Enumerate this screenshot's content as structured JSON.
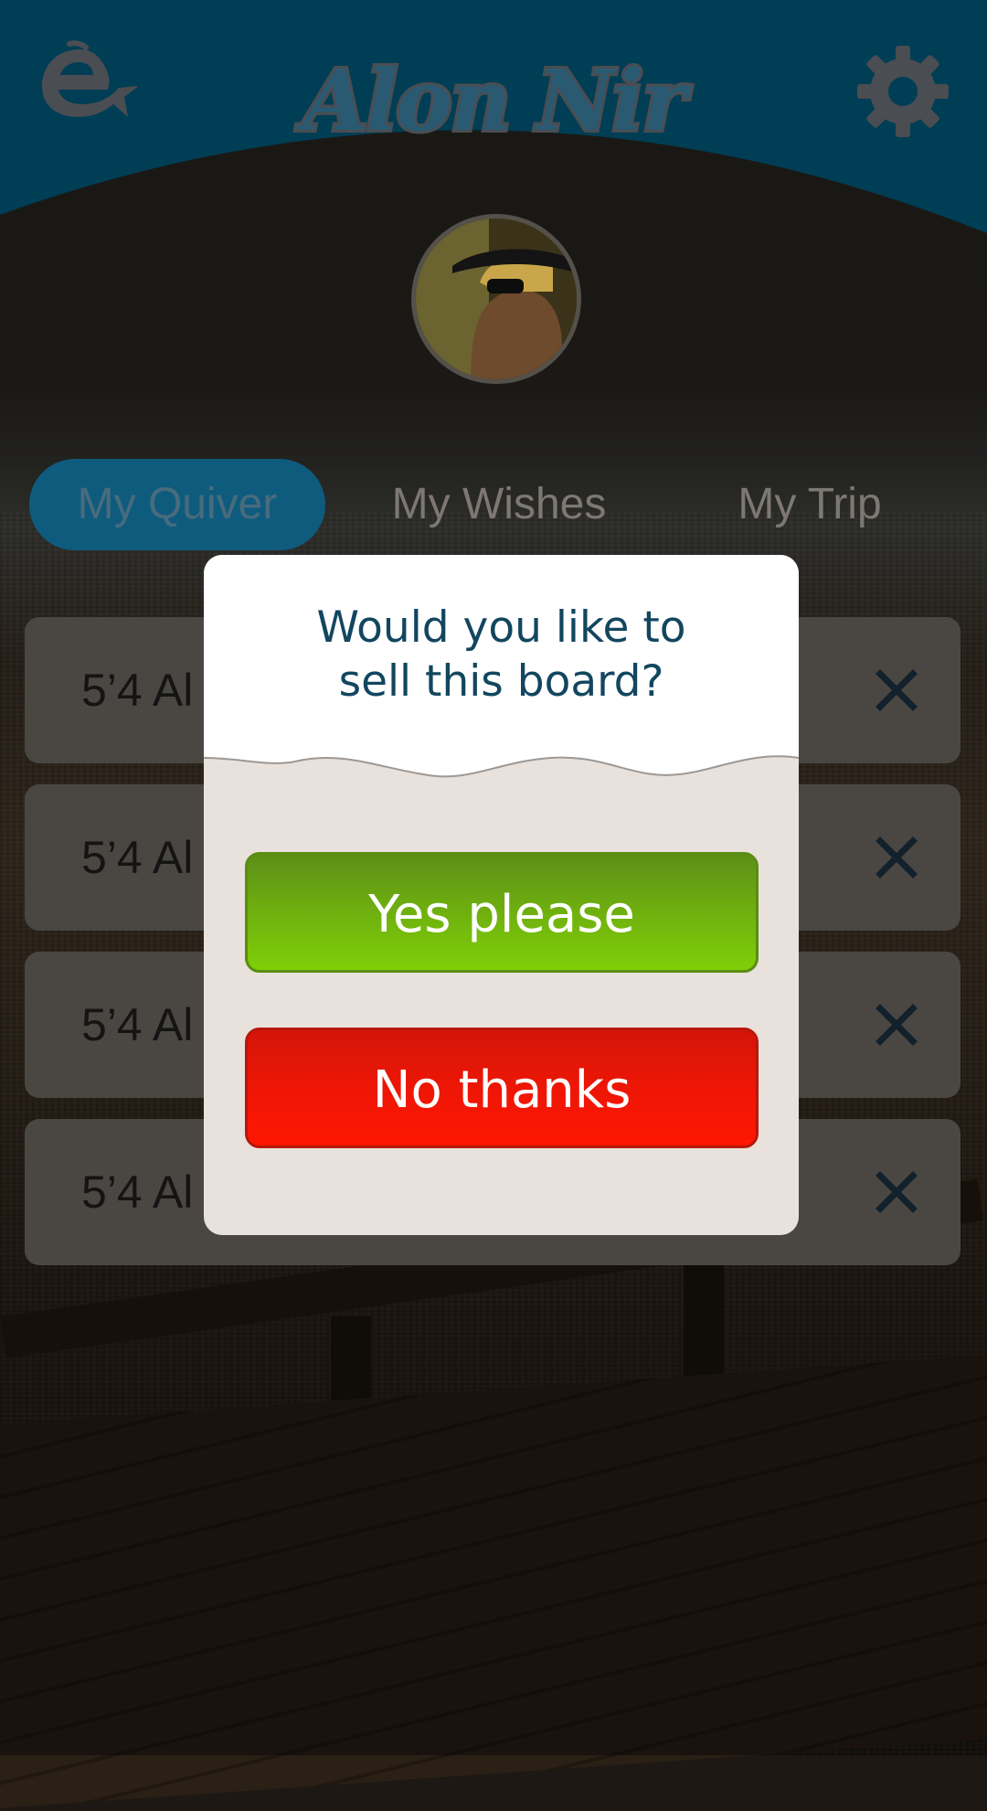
{
  "header": {
    "title": "Alon Nir",
    "logo_icon": "fish-logo-icon",
    "settings_icon": "gear-icon",
    "bar_color": "#003e55"
  },
  "profile": {
    "avatar_icon": "user-avatar"
  },
  "tabs": [
    {
      "label": "My Quiver",
      "active": true
    },
    {
      "label": "My Wishes",
      "active": false
    },
    {
      "label": "My Trip",
      "active": false
    }
  ],
  "boards": [
    {
      "label": "5’4 Al"
    },
    {
      "label": "5’4 Al"
    },
    {
      "label": "5’4 Al"
    },
    {
      "label": "5’4 Al"
    }
  ],
  "modal": {
    "question_line1": "Would you like to",
    "question_line2": "sell this board?",
    "yes_label": "Yes please",
    "no_label": "No thanks",
    "yes_color": "#6fb00f",
    "no_color": "#ee1606"
  }
}
